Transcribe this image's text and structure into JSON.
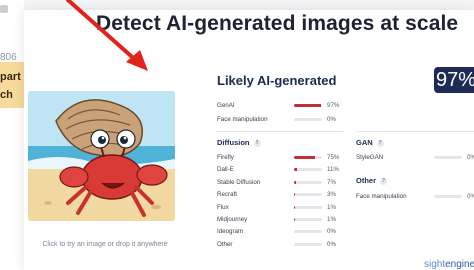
{
  "background_page": {
    "text_1": "806",
    "text_2": "part",
    "text_3": "ch"
  },
  "title": "Detect AI-generated images at scale",
  "image": {
    "caption": "Click to try an image or drop it anywhere"
  },
  "result": {
    "verdict": "Likely AI-generated",
    "score": "97%"
  },
  "top_rows": [
    {
      "label": "GenAI",
      "pct": "97%",
      "value": 0.97
    },
    {
      "label": "Face manipulation",
      "pct": "0%",
      "value": 0.0
    }
  ],
  "diffusion": {
    "title": "Diffusion",
    "help": "?",
    "rows": [
      {
        "label": "Firefly",
        "pct": "75%",
        "value": 0.75
      },
      {
        "label": "Dall-E",
        "pct": "11%",
        "value": 0.11
      },
      {
        "label": "Stable Diffusion",
        "pct": "7%",
        "value": 0.07
      },
      {
        "label": "Recraft",
        "pct": "3%",
        "value": 0.03
      },
      {
        "label": "Flux",
        "pct": "1%",
        "value": 0.01
      },
      {
        "label": "Midjourney",
        "pct": "1%",
        "value": 0.01
      },
      {
        "label": "Ideogram",
        "pct": "0%",
        "value": 0.0
      },
      {
        "label": "Other",
        "pct": "0%",
        "value": 0.0
      }
    ]
  },
  "gan": {
    "title": "GAN",
    "help": "?",
    "rows": [
      {
        "label": "StyleGAN",
        "pct": "0%",
        "value": 0.0
      }
    ]
  },
  "other": {
    "title": "Other",
    "help": "?",
    "rows": [
      {
        "label": "Face manipulation",
        "pct": "0%",
        "value": 0.0
      }
    ]
  },
  "brand": {
    "part1": "sight",
    "part2": "engine"
  },
  "colors": {
    "accent": "#c22d3a",
    "navy": "#1d2b55",
    "bar_track": "#e3e6ea",
    "brand": "#5b8bd6"
  }
}
